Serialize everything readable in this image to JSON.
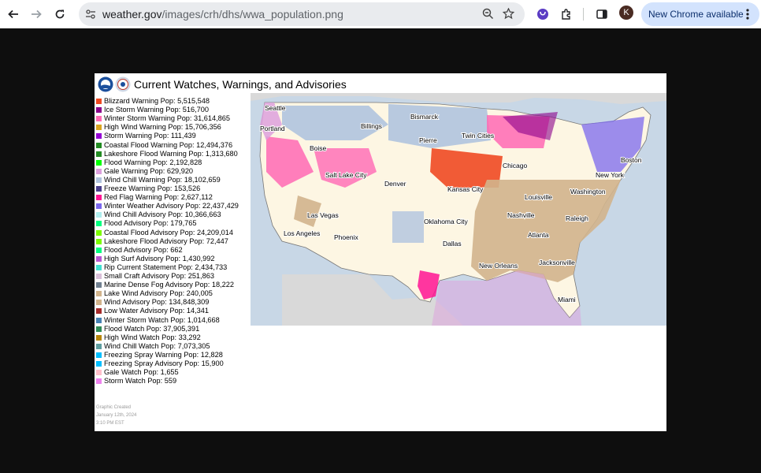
{
  "browser": {
    "url_host": "weather.gov",
    "url_path": "/images/crh/dhs/wwa_population.png",
    "update_pill": "New Chrome available",
    "avatar_letter": "K"
  },
  "graphic": {
    "title": "Current Watches, Warnings, and Advisories",
    "legend": [
      {
        "label": "Blizzard Warning  Pop: 5,515,548",
        "color": "#f04a22"
      },
      {
        "label": "Ice Storm Warning  Pop: 516,700",
        "color": "#8b008b"
      },
      {
        "label": "Winter Storm Warning  Pop: 31,614,865",
        "color": "#ff69b4"
      },
      {
        "label": "High Wind Warning  Pop: 15,706,356",
        "color": "#daa520"
      },
      {
        "label": "Storm Warning  Pop: 111,439",
        "color": "#9400d3"
      },
      {
        "label": "Coastal Flood Warning  Pop: 12,494,376",
        "color": "#228b22"
      },
      {
        "label": "Lakeshore Flood Warning  Pop: 1,313,680",
        "color": "#228b22"
      },
      {
        "label": "Flood Warning  Pop: 2,192,828",
        "color": "#00ff00"
      },
      {
        "label": "Gale Warning  Pop: 629,920",
        "color": "#dda0dd"
      },
      {
        "label": "Wind Chill Warning  Pop: 18,102,659",
        "color": "#b0c4de"
      },
      {
        "label": "Freeze Warning  Pop: 153,526",
        "color": "#483d8b"
      },
      {
        "label": "Red Flag Warning  Pop: 2,627,112",
        "color": "#ff1493"
      },
      {
        "label": "Winter Weather Advisory  Pop: 22,437,429",
        "color": "#7b68ee"
      },
      {
        "label": "Wind Chill Advisory  Pop: 10,366,663",
        "color": "#afeeee"
      },
      {
        "label": "Flood Advisory  Pop: 179,765",
        "color": "#00ff7f"
      },
      {
        "label": "Coastal Flood Advisory  Pop: 24,209,014",
        "color": "#7cfc00"
      },
      {
        "label": "Lakeshore Flood Advisory  Pop: 72,447",
        "color": "#7cfc00"
      },
      {
        "label": "Flood Advisory  Pop: 662",
        "color": "#00ff7f"
      },
      {
        "label": "High Surf Advisory  Pop: 1,430,992",
        "color": "#ba55d3"
      },
      {
        "label": "Rip Current Statement  Pop: 2,434,733",
        "color": "#40e0d0"
      },
      {
        "label": "Small Craft Advisory  Pop: 251,863",
        "color": "#d8bfd8"
      },
      {
        "label": "Marine Dense Fog Advisory  Pop: 18,222",
        "color": "#708090"
      },
      {
        "label": "Lake Wind Advisory  Pop: 240,005",
        "color": "#d2b48c"
      },
      {
        "label": "Wind Advisory  Pop: 134,848,309",
        "color": "#d2b48c"
      },
      {
        "label": "Low Water Advisory  Pop: 14,341",
        "color": "#a52a2a"
      },
      {
        "label": "Winter Storm Watch  Pop: 1,014,668",
        "color": "#4682b4"
      },
      {
        "label": "Flood Watch  Pop: 37,905,391",
        "color": "#2e8b57"
      },
      {
        "label": "High Wind Watch  Pop: 33,292",
        "color": "#b8860b"
      },
      {
        "label": "Wind Chill Watch  Pop: 7,073,305",
        "color": "#5f9ea0"
      },
      {
        "label": "Freezing Spray Warning  Pop: 12,828",
        "color": "#00bfff"
      },
      {
        "label": "Freezing Spray Advisory  Pop: 15,900",
        "color": "#00bfff"
      },
      {
        "label": "Gale Watch  Pop: 1,655",
        "color": "#ffc0cb"
      },
      {
        "label": "Storm Watch  Pop: 559",
        "color": "#ee82ee"
      }
    ],
    "credit_lines": [
      "Graphic Created",
      "January 12th, 2024",
      "3:10 PM EST"
    ],
    "cities": [
      {
        "name": "Seattle"
      },
      {
        "name": "Portland"
      },
      {
        "name": "Billings"
      },
      {
        "name": "Bismarck"
      },
      {
        "name": "Boise"
      },
      {
        "name": "Pierre"
      },
      {
        "name": "Twin Cities"
      },
      {
        "name": "Salt Lake City"
      },
      {
        "name": "Denver"
      },
      {
        "name": "Chicago"
      },
      {
        "name": "Boston"
      },
      {
        "name": "New York"
      },
      {
        "name": "Washington"
      },
      {
        "name": "Kansas City"
      },
      {
        "name": "Louisville"
      },
      {
        "name": "Las Vegas"
      },
      {
        "name": "Nashville"
      },
      {
        "name": "Raleigh"
      },
      {
        "name": "Oklahoma City"
      },
      {
        "name": "Los Angeles"
      },
      {
        "name": "Phoenix"
      },
      {
        "name": "Atlanta"
      },
      {
        "name": "Dallas"
      },
      {
        "name": "New Orleans"
      },
      {
        "name": "Jacksonville"
      },
      {
        "name": "Miami"
      }
    ]
  }
}
